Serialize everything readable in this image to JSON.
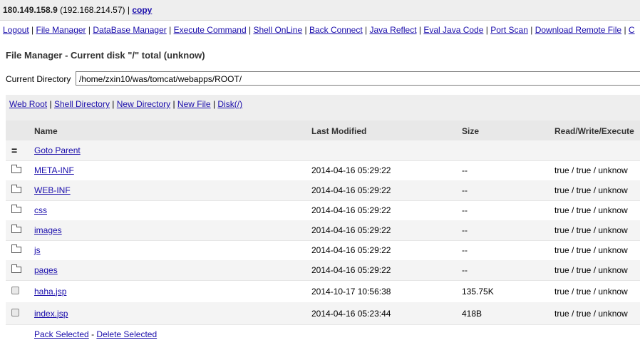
{
  "topbar": {
    "ip": "180.149.158.9",
    "local_ip": "(192.168.214.57)",
    "separator": "|",
    "copy_label": "copy"
  },
  "menu": [
    {
      "label": "Logout"
    },
    {
      "label": "File Manager"
    },
    {
      "label": "DataBase Manager"
    },
    {
      "label": "Execute Command"
    },
    {
      "label": "Shell OnLine"
    },
    {
      "label": "Back Connect"
    },
    {
      "label": "Java Reflect"
    },
    {
      "label": "Eval Java Code"
    },
    {
      "label": "Port Scan"
    },
    {
      "label": "Download Remote File"
    },
    {
      "label": "C"
    }
  ],
  "page": {
    "title": "File Manager - Current disk \"/\" total (unknow)",
    "current_dir_label": "Current Directory",
    "current_dir_value": "/home/zxin10/was/tomcat/webapps/ROOT/"
  },
  "actions": [
    {
      "label": "Web Root"
    },
    {
      "label": "Shell Directory"
    },
    {
      "label": "New Directory"
    },
    {
      "label": "New File"
    },
    {
      "label": "Disk(/)"
    }
  ],
  "table": {
    "headers": {
      "name": "Name",
      "modified": "Last Modified",
      "size": "Size",
      "rwx": "Read/Write/Execute"
    },
    "parent": {
      "icon": "=",
      "label": "Goto Parent"
    },
    "rows": [
      {
        "type": "folder",
        "name": "META-INF",
        "modified": "2014-04-16 05:29:22",
        "size": "--",
        "rwx": "true / true / unknow"
      },
      {
        "type": "folder",
        "name": "WEB-INF",
        "modified": "2014-04-16 05:29:22",
        "size": "--",
        "rwx": "true / true / unknow"
      },
      {
        "type": "folder",
        "name": "css",
        "modified": "2014-04-16 05:29:22",
        "size": "--",
        "rwx": "true / true / unknow"
      },
      {
        "type": "folder",
        "name": "images",
        "modified": "2014-04-16 05:29:22",
        "size": "--",
        "rwx": "true / true / unknow"
      },
      {
        "type": "folder",
        "name": "js",
        "modified": "2014-04-16 05:29:22",
        "size": "--",
        "rwx": "true / true / unknow"
      },
      {
        "type": "folder",
        "name": "pages",
        "modified": "2014-04-16 05:29:22",
        "size": "--",
        "rwx": "true / true / unknow"
      },
      {
        "type": "file",
        "name": "haha.jsp",
        "modified": "2014-10-17 10:56:38",
        "size": "135.75K",
        "rwx": "true / true / unknow"
      },
      {
        "type": "file",
        "name": "index.jsp",
        "modified": "2014-04-16 05:23:44",
        "size": "418B",
        "rwx": "true / true / unknow"
      }
    ]
  },
  "footer": {
    "pack_label": "Pack Selected",
    "dash": "-",
    "delete_label": "Delete Selected"
  },
  "icons": {
    "folder": "folder-icon",
    "file_checkbox": "file-select-checkbox",
    "parent": "parent-directory-icon"
  },
  "colors": {
    "link": "#1a0dab",
    "bar_background": "#eeeeee"
  }
}
